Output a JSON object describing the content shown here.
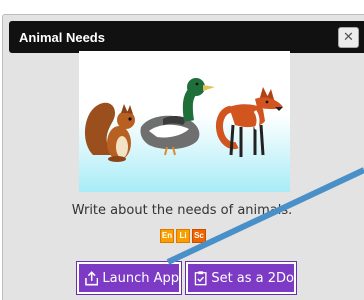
{
  "dialog": {
    "title": "Animal Needs",
    "close_glyph": "✕",
    "close_icon": "close-icon"
  },
  "hero": {
    "image": "squirrel-duck-fox-illustration",
    "bg_top": "#ffffff",
    "bg_bottom": "#a8ecf7"
  },
  "description": "Write about the needs of animals.",
  "tags": [
    {
      "label": "En",
      "color": "#f7a000"
    },
    {
      "label": "Li",
      "color": "#f7a000"
    },
    {
      "label": "Sc",
      "color": "#f06400"
    }
  ],
  "actions": {
    "launch_label": "Launch App",
    "launch_icon": "launch-icon",
    "twodo_label": "Set as a 2Do",
    "twodo_icon": "clipboard-check-icon",
    "button_color": "#7d3bc5"
  },
  "annotation": {
    "type": "arrow-pointer",
    "color": "#4a90c8"
  }
}
